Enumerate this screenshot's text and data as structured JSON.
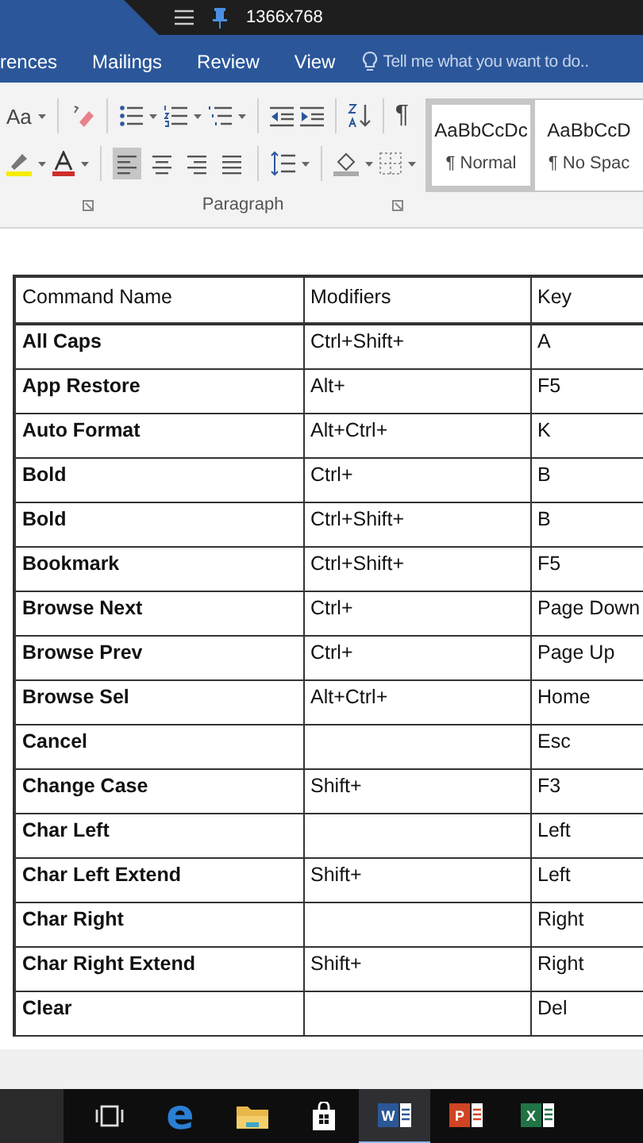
{
  "recorder_bar": {
    "resolution": "1366x768"
  },
  "tabs": [
    {
      "label": "rences",
      "selected": false
    },
    {
      "label": "Mailings",
      "selected": false
    },
    {
      "label": "Review",
      "selected": false
    },
    {
      "label": "View",
      "selected": false
    }
  ],
  "tell_me": {
    "placeholder": "Tell me what you want to do.."
  },
  "ribbon": {
    "case_button": "Aa",
    "show_marks": "¶",
    "group_label": "Paragraph",
    "alignments": [
      {
        "kind": "left",
        "selected": true
      },
      {
        "kind": "center",
        "selected": false
      },
      {
        "kind": "right",
        "selected": false
      },
      {
        "kind": "justify",
        "selected": false
      }
    ],
    "styles": [
      {
        "preview": "AaBbCcDc",
        "name": "¶ Normal",
        "selected": true
      },
      {
        "preview": "AaBbCcD",
        "name": "¶ No Spac",
        "selected": false
      }
    ]
  },
  "table": {
    "columns": [
      "Command Name",
      "Modifiers",
      "Key"
    ],
    "rows": [
      {
        "command": "All Caps",
        "modifiers": "Ctrl+Shift+",
        "key": "A"
      },
      {
        "command": "App Restore",
        "modifiers": "Alt+",
        "key": "F5"
      },
      {
        "command": "Auto Format",
        "modifiers": "Alt+Ctrl+",
        "key": "K"
      },
      {
        "command": "Bold",
        "modifiers": "Ctrl+",
        "key": "B"
      },
      {
        "command": "Bold",
        "modifiers": "Ctrl+Shift+",
        "key": "B"
      },
      {
        "command": "Bookmark",
        "modifiers": "Ctrl+Shift+",
        "key": "F5"
      },
      {
        "command": "Browse Next",
        "modifiers": "Ctrl+",
        "key": "Page Down"
      },
      {
        "command": "Browse Prev",
        "modifiers": "Ctrl+",
        "key": "Page Up"
      },
      {
        "command": "Browse Sel",
        "modifiers": "Alt+Ctrl+",
        "key": "Home"
      },
      {
        "command": "Cancel",
        "modifiers": "",
        "key": "Esc"
      },
      {
        "command": "Change Case",
        "modifiers": "Shift+",
        "key": "F3"
      },
      {
        "command": "Char Left",
        "modifiers": "",
        "key": "Left"
      },
      {
        "command": "Char Left Extend",
        "modifiers": "Shift+",
        "key": "Left"
      },
      {
        "command": "Char Right",
        "modifiers": "",
        "key": "Right"
      },
      {
        "command": "Char Right Extend",
        "modifiers": "Shift+",
        "key": "Right"
      },
      {
        "command": "Clear",
        "modifiers": "",
        "key": "Del"
      }
    ]
  },
  "taskbar": [
    {
      "kind": "task-view",
      "selected": false
    },
    {
      "kind": "browser",
      "glyph": "e",
      "selected": false
    },
    {
      "kind": "folder",
      "selected": false
    },
    {
      "kind": "store",
      "selected": false
    },
    {
      "kind": "word",
      "glyph": "W",
      "selected": true
    },
    {
      "kind": "powerpoint",
      "glyph": "P",
      "selected": false
    },
    {
      "kind": "excel",
      "glyph": "X",
      "selected": false
    }
  ]
}
